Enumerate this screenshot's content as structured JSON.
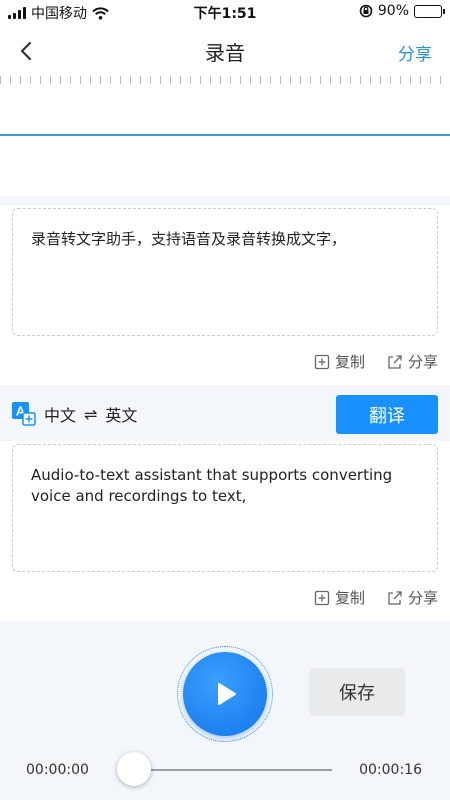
{
  "status_bar": {
    "carrier": "中国移动",
    "time": "下午1:51",
    "battery": "90%",
    "battery_level": 0.9
  },
  "nav": {
    "title": "录音",
    "share_label": "分享"
  },
  "source_panel": {
    "text": "录音转文字助手，支持语音及录音转换成文字，",
    "copy_label": "复制",
    "share_label": "分享"
  },
  "language": {
    "from": "中文",
    "swap_symbol": "⇌",
    "to": "英文"
  },
  "translate_label": "翻译",
  "target_panel": {
    "text": "Audio-to-text assistant that supports converting voice and recordings to text,",
    "copy_label": "复制",
    "share_label": "分享"
  },
  "player": {
    "save_label": "保存",
    "current_time": "00:00:00",
    "total_time": "00:00:16",
    "progress": 0
  },
  "colors": {
    "accent": "#1890ff",
    "waveform_line": "#3a9ad9",
    "background": "#f3f6fa"
  },
  "icons": {
    "back": "chevron-left-icon",
    "copy": "copy-icon",
    "share": "share-icon",
    "translate": "translate-icon",
    "play": "play-icon"
  }
}
